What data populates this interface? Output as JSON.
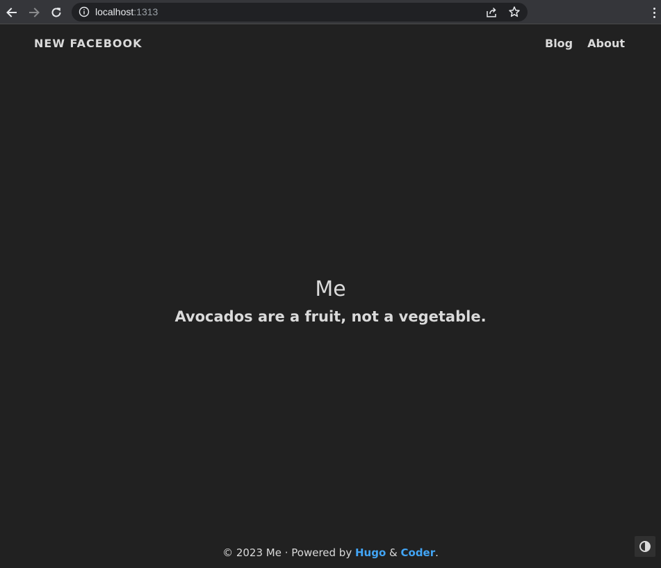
{
  "browser": {
    "url_host": "localhost",
    "url_port": ":1313",
    "icons": [
      "back-arrow-icon",
      "forward-arrow-icon",
      "reload-icon",
      "info-icon",
      "share-icon",
      "star-icon",
      "kebab-menu-icon"
    ]
  },
  "header": {
    "site_title": "NEW FACEBOOK",
    "nav": [
      {
        "label": "Blog"
      },
      {
        "label": "About"
      }
    ]
  },
  "main": {
    "title": "Me",
    "subtitle": "Avocados are a fruit, not a vegetable."
  },
  "footer": {
    "prefix": "© 2023 Me · Powered by ",
    "link1": "Hugo",
    "joiner": " & ",
    "link2": "Coder",
    "suffix": ".",
    "link_color": "#42a5f5"
  },
  "theme_toggle": {
    "icon": "contrast-icon"
  },
  "colors": {
    "background": "#212121",
    "text": "#dadada",
    "chrome": "#35363a"
  }
}
